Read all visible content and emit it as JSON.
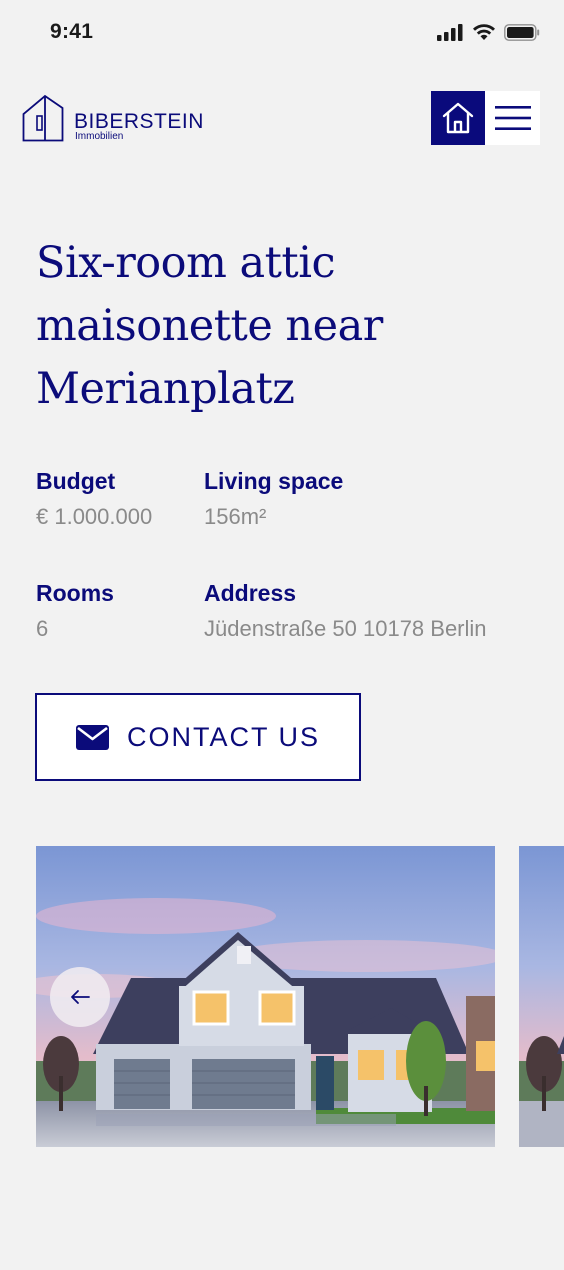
{
  "status_bar": {
    "time": "9:41"
  },
  "header": {
    "logo": {
      "name": "BIBERSTEIN",
      "subtitle": "Immobilien"
    },
    "home_icon": "home-icon",
    "menu_icon": "hamburger-menu-icon"
  },
  "listing": {
    "title": "Six-room attic maisonette near Merianplatz",
    "details": {
      "budget": {
        "label": "Budget",
        "value": "€ 1.000.000"
      },
      "living_space": {
        "label": "Living space",
        "value": "156m²"
      },
      "rooms": {
        "label": "Rooms",
        "value": "6"
      },
      "address": {
        "label": "Address",
        "value": "Jüdenstraße 50 10178 Berlin"
      }
    }
  },
  "contact": {
    "label": "CONTACT US",
    "icon": "envelope-icon"
  },
  "gallery": {
    "prev_icon": "arrow-left-icon"
  },
  "colors": {
    "brand": "#0b0b7a",
    "muted_text": "#8a8a8a",
    "background": "#f2f2f2"
  }
}
